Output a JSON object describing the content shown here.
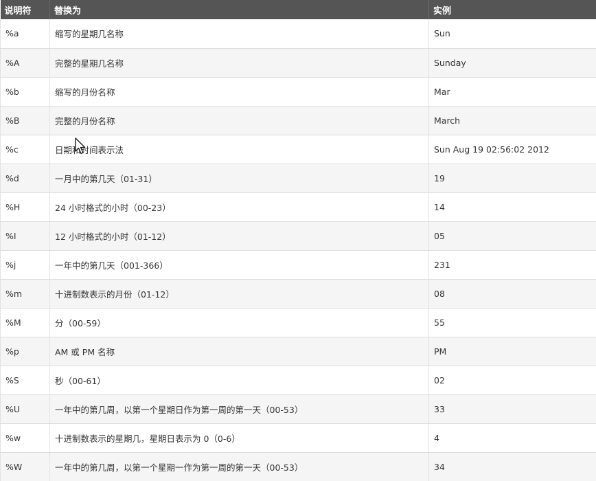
{
  "table": {
    "headers": [
      "说明符",
      "替换为",
      "实例"
    ],
    "rows": [
      {
        "spec": "%a",
        "desc": "缩写的星期几名称",
        "example": "Sun"
      },
      {
        "spec": "%A",
        "desc": "完整的星期几名称",
        "example": "Sunday"
      },
      {
        "spec": "%b",
        "desc": "缩写的月份名称",
        "example": "Mar"
      },
      {
        "spec": "%B",
        "desc": "完整的月份名称",
        "example": "March"
      },
      {
        "spec": "%c",
        "desc": "日期和时间表示法",
        "example": "Sun Aug 19 02:56:02 2012"
      },
      {
        "spec": "%d",
        "desc": "一月中的第几天（01-31）",
        "example": "19"
      },
      {
        "spec": "%H",
        "desc": "24 小时格式的小时（00-23）",
        "example": "14"
      },
      {
        "spec": "%I",
        "desc": "12 小时格式的小时（01-12）",
        "example": "05"
      },
      {
        "spec": "%j",
        "desc": "一年中的第几天（001-366）",
        "example": "231"
      },
      {
        "spec": "%m",
        "desc": "十进制数表示的月份（01-12）",
        "example": "08"
      },
      {
        "spec": "%M",
        "desc": "分（00-59）",
        "example": "55"
      },
      {
        "spec": "%p",
        "desc": "AM 或 PM 名称",
        "example": "PM"
      },
      {
        "spec": "%S",
        "desc": "秒（00-61）",
        "example": "02"
      },
      {
        "spec": "%U",
        "desc": "一年中的第几周，以第一个星期日作为第一周的第一天（00-53）",
        "example": "33"
      },
      {
        "spec": "%w",
        "desc": "十进制数表示的星期几，星期日表示为 0（0-6）",
        "example": "4"
      },
      {
        "spec": "%W",
        "desc": "一年中的第几周，以第一个星期一作为第一周的第一天（00-53）",
        "example": "34"
      }
    ]
  },
  "cursor": {
    "icon": "mouse-pointer-icon"
  }
}
